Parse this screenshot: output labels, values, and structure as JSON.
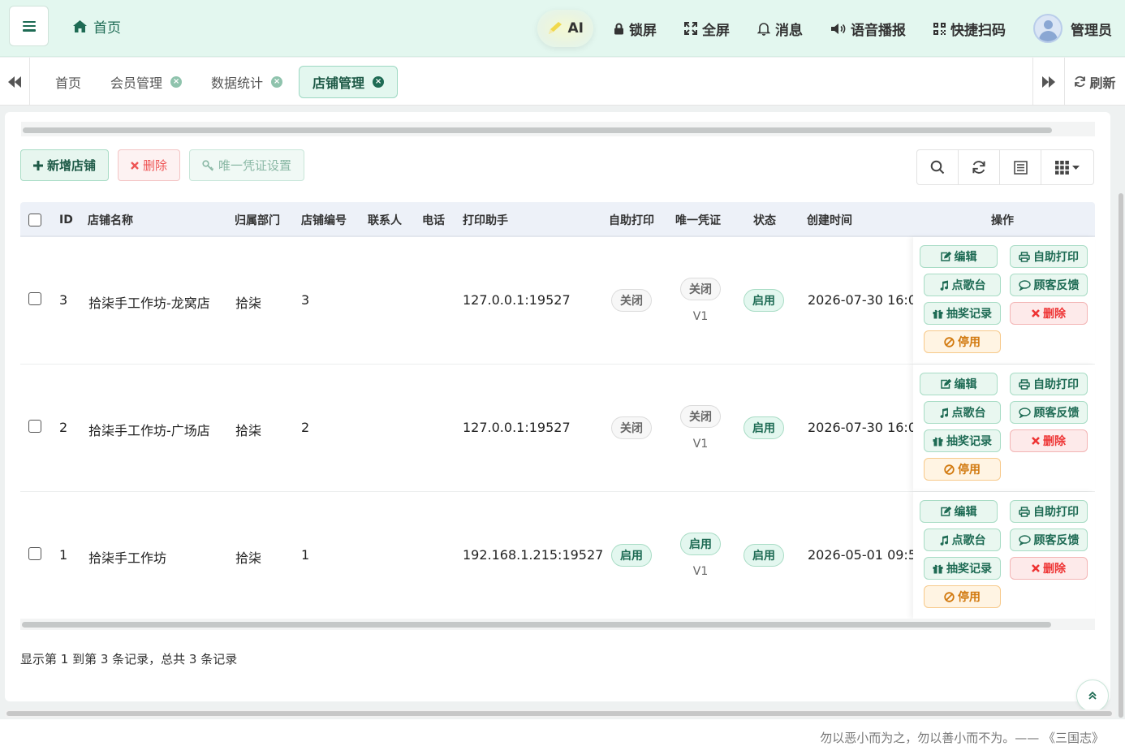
{
  "header": {
    "home_label": "首页",
    "ai_label": "AI",
    "lock_label": "锁屏",
    "fullscreen_label": "全屏",
    "messages_label": "消息",
    "voice_label": "语音播报",
    "scan_label": "快捷扫码",
    "user_label": "管理员"
  },
  "tabs": [
    {
      "label": "首页",
      "closable": false
    },
    {
      "label": "会员管理",
      "closable": true
    },
    {
      "label": "数据统计",
      "closable": true
    },
    {
      "label": "店铺管理",
      "closable": true,
      "active": true
    }
  ],
  "tabbar": {
    "refresh_label": "刷新"
  },
  "toolbar": {
    "add_label": "新增店铺",
    "delete_label": "删除",
    "credential_label": "唯一凭证设置"
  },
  "table": {
    "columns": {
      "id": "ID",
      "name": "店铺名称",
      "dept": "归属部门",
      "code": "店铺编号",
      "contact": "联系人",
      "phone": "电话",
      "printer": "打印助手",
      "self_print": "自助打印",
      "credential": "唯一凭证",
      "status": "状态",
      "created": "创建时间",
      "ops": "操作"
    },
    "rows": [
      {
        "id": "3",
        "name": "拾柒手工作坊-龙窝店",
        "dept": "拾柒",
        "code": "3",
        "contact": "",
        "phone": "",
        "printer": "127.0.0.1:19527",
        "self_print": "关闭",
        "self_print_on": false,
        "credential": "关闭",
        "credential_on": false,
        "version": "V1",
        "status": "启用",
        "created": "2026-07-30 16:0"
      },
      {
        "id": "2",
        "name": "拾柒手工作坊-广场店",
        "dept": "拾柒",
        "code": "2",
        "contact": "",
        "phone": "",
        "printer": "127.0.0.1:19527",
        "self_print": "关闭",
        "self_print_on": false,
        "credential": "关闭",
        "credential_on": false,
        "version": "V1",
        "status": "启用",
        "created": "2026-07-30 16:0"
      },
      {
        "id": "1",
        "name": "拾柒手工作坊",
        "dept": "拾柒",
        "code": "1",
        "contact": "",
        "phone": "",
        "printer": "192.168.1.215:19527",
        "self_print": "启用",
        "self_print_on": true,
        "credential": "启用",
        "credential_on": true,
        "version": "V1",
        "status": "启用",
        "created": "2026-05-01 09:5"
      }
    ],
    "ops": {
      "edit": "编辑",
      "self_print": "自助打印",
      "karaoke": "点歌台",
      "feedback": "顾客反馈",
      "lottery": "抽奖记录",
      "delete": "删除",
      "disable": "停用"
    }
  },
  "records_text": "显示第 1 到第 3 条记录，总共 3 条记录",
  "footer_quote": "勿以恶小而为之，勿以善小而不为。—— 《三国志》",
  "colors": {
    "accent": "#1e6b54",
    "header_bg": "#e3f7ef",
    "danger": "#e33333",
    "warning": "#d27a10"
  }
}
